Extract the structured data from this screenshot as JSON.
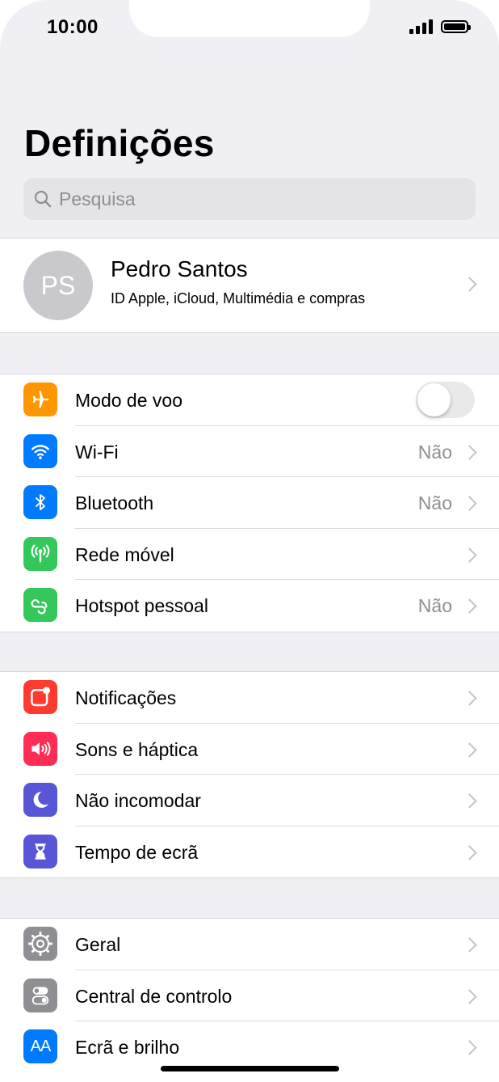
{
  "status": {
    "time": "10:00"
  },
  "title": "Definições",
  "search": {
    "placeholder": "Pesquisa"
  },
  "profile": {
    "initials": "PS",
    "name": "Pedro Santos",
    "subtitle": "ID Apple, iCloud, Multimédia e compras"
  },
  "group1": [
    {
      "label": "Modo de voo",
      "icon": "airplane-icon",
      "color": "#ff9500",
      "toggle": false
    },
    {
      "label": "Wi-Fi",
      "value": "Não",
      "icon": "wifi-icon",
      "color": "#007aff"
    },
    {
      "label": "Bluetooth",
      "value": "Não",
      "icon": "bluetooth-icon",
      "color": "#007aff"
    },
    {
      "label": "Rede móvel",
      "icon": "antenna-icon",
      "color": "#34c759"
    },
    {
      "label": "Hotspot pessoal",
      "value": "Não",
      "icon": "hotspot-icon",
      "color": "#34c759"
    }
  ],
  "group2": [
    {
      "label": "Notificações",
      "icon": "notifications-icon",
      "color": "#ff3b30"
    },
    {
      "label": "Sons e háptica",
      "icon": "speaker-icon",
      "color": "#ff2d55"
    },
    {
      "label": "Não incomodar",
      "icon": "moon-icon",
      "color": "#5856d6"
    },
    {
      "label": "Tempo de ecrã",
      "icon": "hourglass-icon",
      "color": "#5856d6"
    }
  ],
  "group3": [
    {
      "label": "Geral",
      "icon": "gear-icon",
      "color": "#8e8e93"
    },
    {
      "label": "Central de controlo",
      "icon": "switches-icon",
      "color": "#8e8e93"
    },
    {
      "label": "Ecrã e brilho",
      "icon": "text-size-icon",
      "color": "#007aff",
      "icon_text": "AA"
    }
  ]
}
